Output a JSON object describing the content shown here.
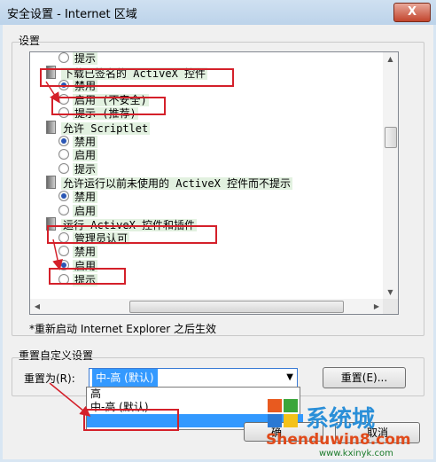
{
  "window": {
    "title": "安全设置 - Internet 区域",
    "close_glyph": "X"
  },
  "settings": {
    "group_label": "设置",
    "items": [
      {
        "kind": "option",
        "label": "提示",
        "checked": false
      },
      {
        "kind": "header",
        "label": "下载已签名的 ActiveX 控件"
      },
      {
        "kind": "option",
        "label": "禁用",
        "checked": true
      },
      {
        "kind": "option",
        "label": "启用 (不安全)",
        "checked": false
      },
      {
        "kind": "option",
        "label": "提示 (推荐)",
        "checked": false
      },
      {
        "kind": "header",
        "label": "允许 Scriptlet"
      },
      {
        "kind": "option",
        "label": "禁用",
        "checked": true
      },
      {
        "kind": "option",
        "label": "启用",
        "checked": false
      },
      {
        "kind": "option",
        "label": "提示",
        "checked": false
      },
      {
        "kind": "header",
        "label": "允许运行以前未使用的 ActiveX 控件而不提示"
      },
      {
        "kind": "option",
        "label": "禁用",
        "checked": true
      },
      {
        "kind": "option",
        "label": "启用",
        "checked": false
      },
      {
        "kind": "header",
        "label": "运行 ActiveX 控件和插件"
      },
      {
        "kind": "option",
        "label": "管理员认可",
        "checked": false
      },
      {
        "kind": "option",
        "label": "禁用",
        "checked": false
      },
      {
        "kind": "option",
        "label": "启用",
        "checked": true
      },
      {
        "kind": "option",
        "label": "提示",
        "checked": false
      }
    ],
    "restart_note": "*重新启动 Internet Explorer 之后生效"
  },
  "reset": {
    "group_label": "重置自定义设置",
    "reset_to_label": "重置为(R):",
    "selected_value": "中-高 (默认)",
    "options": [
      "高",
      "中-高 (默认)",
      ""
    ],
    "reset_button": "重置(E)..."
  },
  "footer": {
    "ok_fragment": "确",
    "cancel_fragment": "取消"
  },
  "watermark": {
    "brand": "系统城",
    "site": "Shenduwin8.com",
    "url": "www.kxinyk.com"
  },
  "colors": {
    "highlight_red": "#d4202a",
    "row_green": "#e2f1e0",
    "selection_blue": "#3399ff"
  }
}
